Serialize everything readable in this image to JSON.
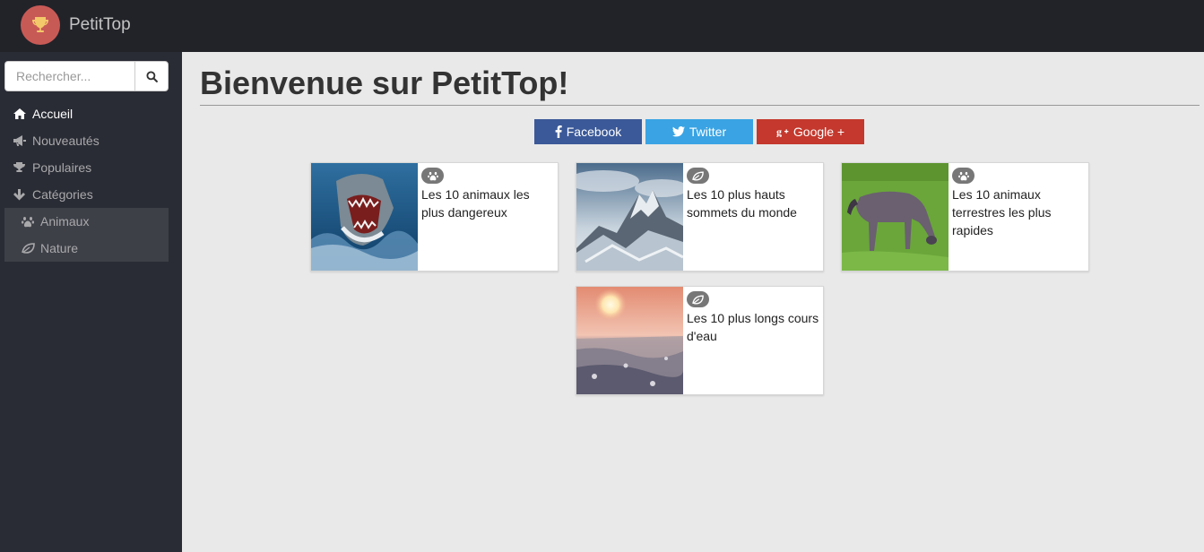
{
  "app": {
    "brand": "PetitTop",
    "logo_icon": "trophy-icon",
    "colors": {
      "topbar": "#222329",
      "sidebar": "#2a2c35",
      "logo": "#c85a56",
      "background": "#e9e9e9"
    }
  },
  "sidebar": {
    "search": {
      "placeholder": "Rechercher...",
      "value": "",
      "button_icon": "search-icon"
    },
    "items": [
      {
        "label": "Accueil",
        "icon": "home-icon",
        "active": true
      },
      {
        "label": "Nouveautés",
        "icon": "bullhorn-icon",
        "active": false
      },
      {
        "label": "Populaires",
        "icon": "trophy-icon",
        "active": false
      },
      {
        "label": "Catégories",
        "icon": "arrow-down-icon",
        "active": false
      }
    ],
    "subitems": [
      {
        "label": "Animaux",
        "icon": "paw-icon"
      },
      {
        "label": "Nature",
        "icon": "leaf-icon"
      }
    ]
  },
  "main": {
    "title": "Bienvenue sur PetitTop!",
    "share": {
      "facebook": {
        "label": "Facebook",
        "color": "#3b5998",
        "icon": "facebook-icon"
      },
      "twitter": {
        "label": "Twitter",
        "color": "#3aa3e3",
        "icon": "twitter-icon"
      },
      "google": {
        "label": "Google +",
        "color": "#c4382d",
        "icon": "google-plus-icon"
      }
    },
    "cards": [
      {
        "title": "Les 10 animaux les plus dangereux",
        "category_icon": "paw-icon",
        "image": "shark-photo"
      },
      {
        "title": "Les 10 plus hauts sommets du monde",
        "category_icon": "leaf-icon",
        "image": "mountain-photo"
      },
      {
        "title": "Les 10 animaux terrestres les plus rapides",
        "category_icon": "paw-icon",
        "image": "wildebeest-photo"
      },
      {
        "title": "Les 10 plus longs cours d'eau",
        "category_icon": "leaf-icon",
        "image": "frozen-river-photo"
      }
    ]
  }
}
